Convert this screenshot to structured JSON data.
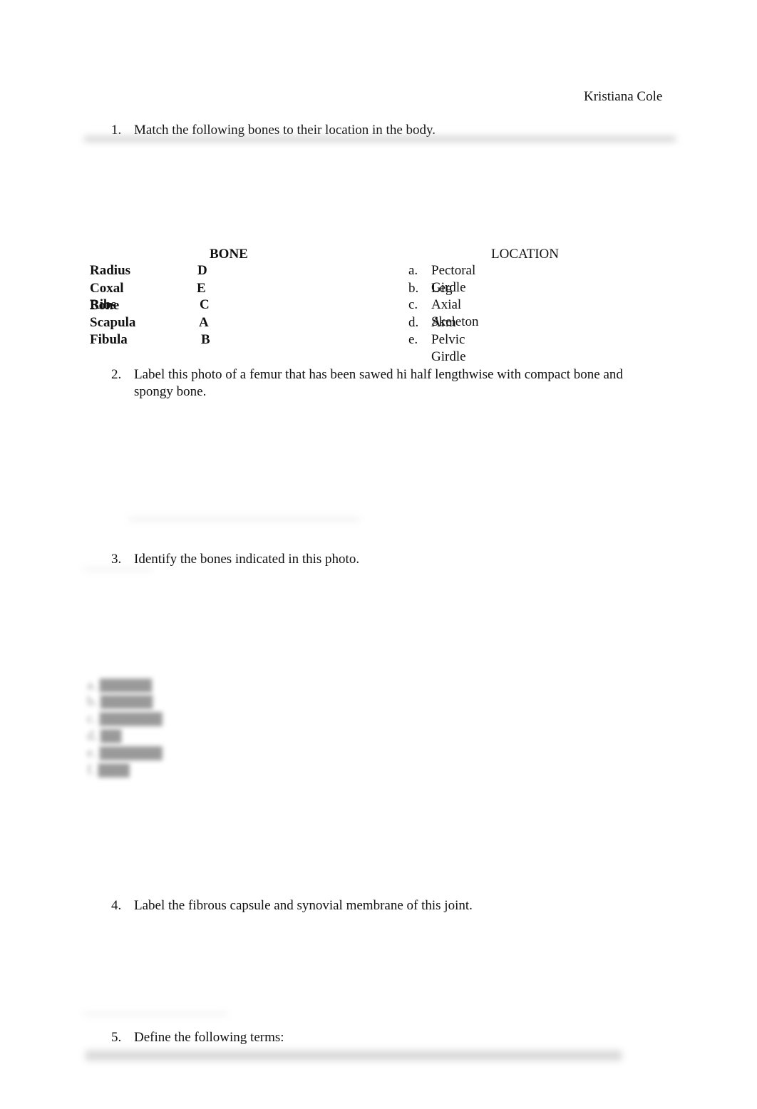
{
  "header": {
    "author": "Kristiana Cole"
  },
  "questions": [
    {
      "number": "1.",
      "text": "Match the following bones to their location in the body."
    },
    {
      "number": "2.",
      "text": "Label this photo of a femur that has been sawed hi half lengthwise with compact bone and spongy bone."
    },
    {
      "number": "3.",
      "text": "Identify the bones indicated in this photo."
    },
    {
      "number": "4.",
      "text": "Label the fibrous capsule and synovial membrane of this joint."
    },
    {
      "number": "5.",
      "text": "Define the following terms:"
    }
  ],
  "matching": {
    "bone_header": "BONE",
    "location_header": "LOCATION",
    "bones": [
      {
        "name": "Radius",
        "answer": "D"
      },
      {
        "name": "Coxal Bone",
        "answer": "E"
      },
      {
        "name": "Ribs",
        "answer": "C"
      },
      {
        "name": "Scapula",
        "answer": "A"
      },
      {
        "name": "Fibula",
        "answer": "B"
      }
    ],
    "locations": [
      {
        "letter": "a.",
        "label": "Pectoral Girdle"
      },
      {
        "letter": "b.",
        "label": "Leg"
      },
      {
        "letter": "c.",
        "label": "Axial Skeleton"
      },
      {
        "letter": "d.",
        "label": "Arm"
      },
      {
        "letter": "e.",
        "label": "Pelvic Girdle"
      }
    ]
  }
}
